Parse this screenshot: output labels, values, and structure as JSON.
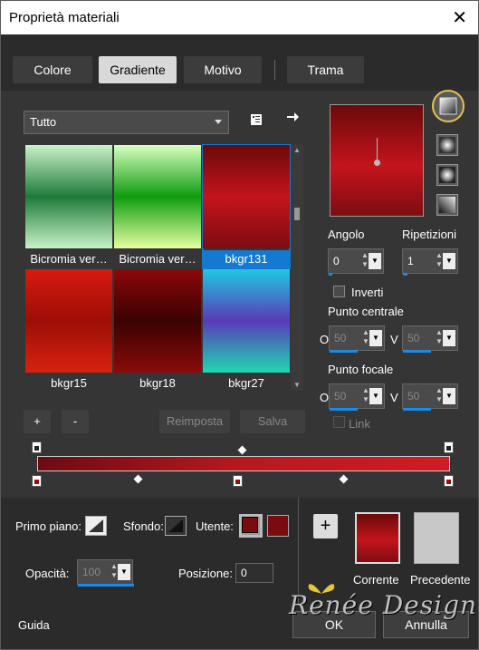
{
  "window": {
    "title": "Proprietà materiali",
    "close": "✕"
  },
  "tabs": [
    {
      "label": "Colore",
      "active": false
    },
    {
      "label": "Gradiente",
      "active": true
    },
    {
      "label": "Motivo",
      "active": false
    },
    {
      "label": "Trama",
      "active": false
    }
  ],
  "category": {
    "selected": "Tutto"
  },
  "gallery": [
    {
      "label": "Bicromia ver…",
      "colors": [
        "#c9f2c9",
        "#1f7a3a",
        "#c9f2c9"
      ]
    },
    {
      "label": "Bicromia ver…",
      "colors": [
        "#d8ffc0",
        "#0e9c10",
        "#e6ffa0"
      ]
    },
    {
      "label": "bkgr131",
      "colors": [
        "#6b0a0a",
        "#c4141c",
        "#7d0d12"
      ],
      "selected": true
    },
    {
      "label": "bkgr15",
      "colors": [
        "#d81a10",
        "#9c0e06",
        "#d82210"
      ]
    },
    {
      "label": "bkgr18",
      "colors": [
        "#8c0808",
        "#3a0202",
        "#8c0a0a"
      ]
    },
    {
      "label": "bkgr27",
      "colors": [
        "#20c8e0",
        "#5a3ab8",
        "#20d8b0"
      ]
    }
  ],
  "gallery_buttons": {
    "add": "+",
    "remove": "-",
    "reset": "Reimposta",
    "save": "Salva"
  },
  "right_panel": {
    "angle_label": "Angolo",
    "angle_value": "0",
    "repeat_label": "Ripetizioni",
    "repeat_value": "1",
    "invert_label": "Inverti",
    "center_label": "Punto centrale",
    "center_o_label": "O",
    "center_o_value": "50",
    "center_v_label": "V",
    "center_v_value": "50",
    "focal_label": "Punto focale",
    "focal_o_label": "O",
    "focal_o_value": "50",
    "focal_v_label": "V",
    "focal_v_value": "50",
    "link_label": "Link"
  },
  "bottom": {
    "foreground_label": "Primo piano:",
    "background_label": "Sfondo:",
    "user_label": "Utente:",
    "user_color": "#7a0c10",
    "opacity_label": "Opacità:",
    "opacity_value": "100",
    "position_label": "Posizione:",
    "position_value": "0",
    "current_label": "Corrente",
    "previous_label": "Precedente",
    "previous_color": "#c8c8c8"
  },
  "footer": {
    "help": "Guida",
    "ok": "OK",
    "cancel": "Annulla",
    "watermark": "Renée Design"
  }
}
